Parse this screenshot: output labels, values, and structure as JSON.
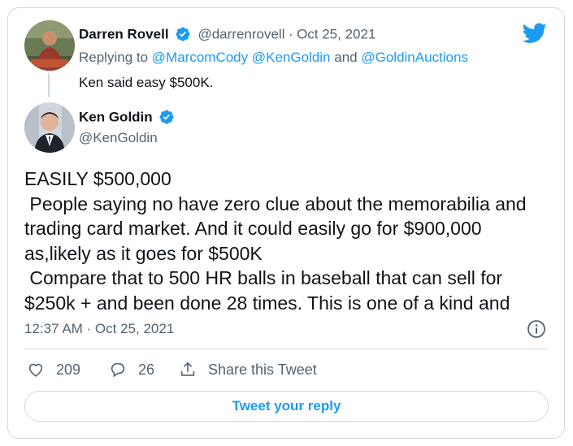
{
  "reply_tweet": {
    "author_name": "Darren Rovell",
    "author_handle": "@darrenrovell",
    "separator": "·",
    "date": "Oct 25, 2021",
    "replying_to_prefix": "Replying to",
    "replying_to_mentions": "@MarcomCody @KenGoldin",
    "replying_and": "and",
    "replying_to_last": "@GoldinAuctions",
    "text": "Ken said easy $500K."
  },
  "main_tweet": {
    "author_name": "Ken Goldin",
    "author_handle": "@KenGoldin",
    "text": "EASILY $500,000\n People saying no have zero clue about the memorabilia and trading card market. And it could easily go for $900,000 as,likely as it goes for $500K\n Compare that to 500 HR balls in baseball that can sell for $250k + and been done 28 times. This is one of a kind and",
    "timestamp": "12:37 AM · Oct 25, 2021"
  },
  "actions": {
    "likes": "209",
    "replies": "26",
    "share_label": "Share this Tweet"
  },
  "reply_button_label": "Tweet your reply",
  "colors": {
    "accent": "#1d9bf0",
    "text": "#0f1419",
    "secondary": "#536471",
    "border": "#cfd9de"
  },
  "icons": [
    "twitter-bird-icon",
    "verified-badge-icon",
    "info-icon",
    "heart-icon",
    "reply-bubble-icon",
    "share-icon"
  ]
}
